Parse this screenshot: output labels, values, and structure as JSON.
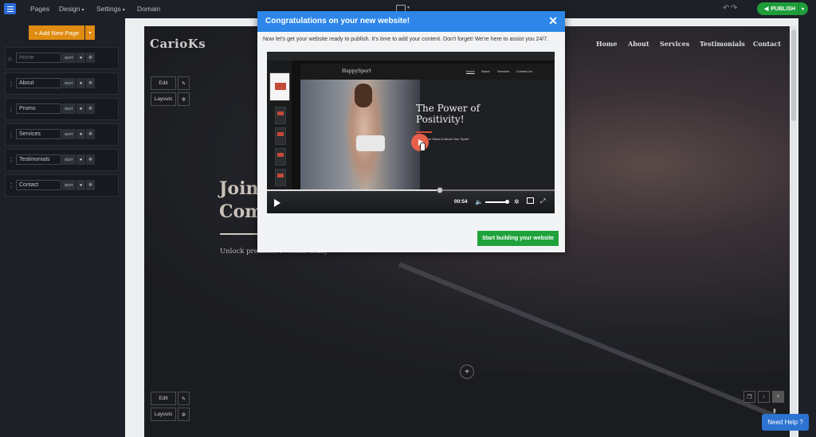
{
  "topbar": {
    "nav": [
      {
        "label": "Pages",
        "has_dropdown": false
      },
      {
        "label": "Design",
        "has_dropdown": true
      },
      {
        "label": "Settings",
        "has_dropdown": true
      },
      {
        "label": "Domain",
        "has_dropdown": false
      }
    ],
    "publish_label": "PUBLISH",
    "publish_color": "#1f9d3a"
  },
  "sidebar": {
    "add_page_label": "+ Add New Page",
    "edit_label": "EDIT",
    "pages": [
      {
        "name": "Home",
        "icon": "home-icon"
      },
      {
        "name": "About",
        "icon": "drag-handle-icon"
      },
      {
        "name": "Promo",
        "icon": "drag-handle-icon"
      },
      {
        "name": "Services",
        "icon": "drag-handle-icon"
      },
      {
        "name": "Testimonials",
        "icon": "drag-handle-icon"
      },
      {
        "name": "Contact",
        "icon": "drag-handle-icon"
      }
    ]
  },
  "site": {
    "logo": "CarioKs",
    "nav": [
      "Home",
      "About",
      "Services",
      "Testimonials",
      "Contact"
    ],
    "hero_line1": "Join",
    "hero_line2": "Com",
    "hero_sub": "Unlock premium benefits today",
    "edit_label": "Edit",
    "layouts_label": "Layouts"
  },
  "modal": {
    "title": "Congratulations on your new website!",
    "text": "Now let's get your website ready to publish. It's time to add your content. Don't forget! We're here to assist you 24/7.",
    "cta": "Start building your website",
    "video": {
      "site_logo": "HappySport",
      "nav": [
        "Home",
        "About",
        "Services",
        "Contact Us"
      ],
      "headline_line1": "The Power of",
      "headline_line2": "Positivity!",
      "tagline": "Boost Your Mood & Boost Your Sport!",
      "time": "00:54",
      "progress": 0.6
    }
  },
  "help": {
    "label": "Need Help ?"
  },
  "colors": {
    "accent": "#2d86e8",
    "orange": "#e08b12",
    "green": "#1fa23b"
  }
}
